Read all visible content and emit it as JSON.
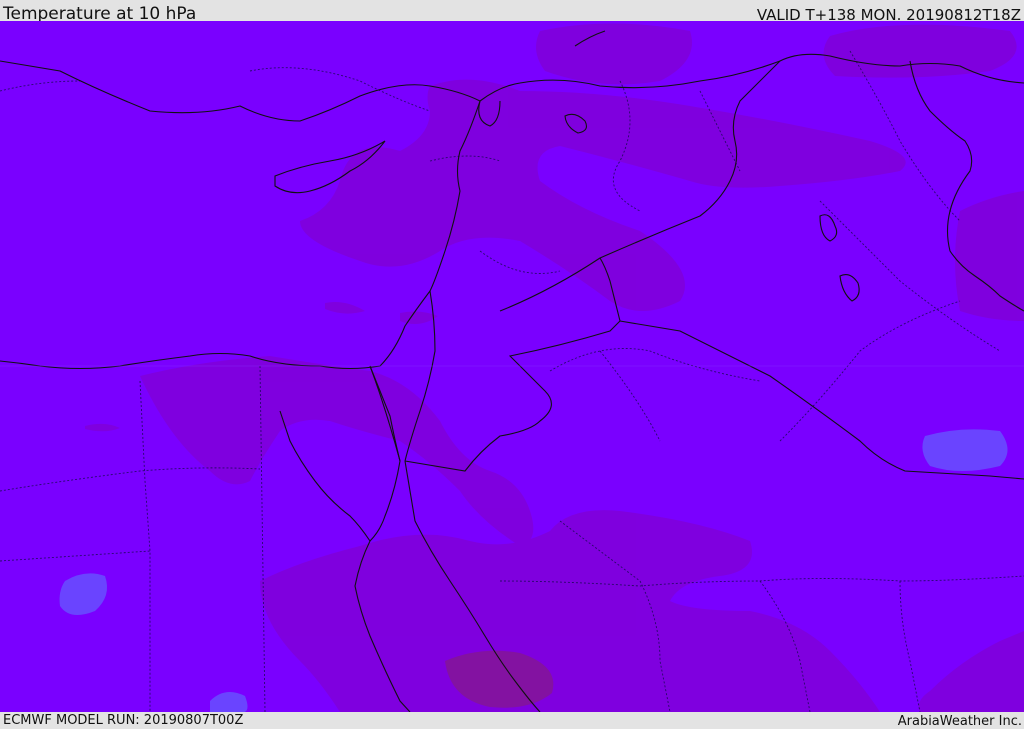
{
  "header": {
    "title": "Temperature at 10 hPa",
    "valid": "VALID T+138 MON. 20190812T18Z"
  },
  "footer": {
    "model_run": "ECMWF MODEL RUN: 20190807T00Z",
    "credit": "ArabiaWeather Inc."
  },
  "map": {
    "base_color": "#7a00ff",
    "shade_color": "#8000dd",
    "cool_color": "#6a44ff",
    "border_color": "#111111"
  }
}
